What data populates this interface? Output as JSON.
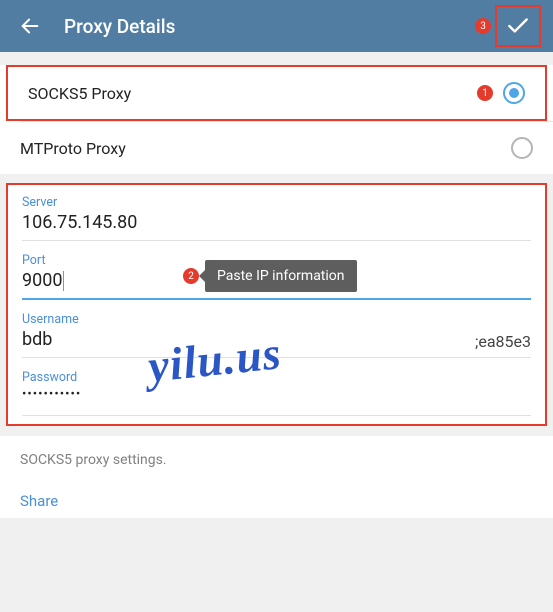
{
  "header": {
    "title": "Proxy Details"
  },
  "annotations": {
    "step1": "1",
    "step2": "2",
    "step3": "3",
    "tooltip": "Paste IP information"
  },
  "proxyTypes": {
    "socks5": "SOCKS5 Proxy",
    "mtproto": "MTProto Proxy"
  },
  "form": {
    "server": {
      "label": "Server",
      "value": "106.75.145.80"
    },
    "port": {
      "label": "Port",
      "value": "9000"
    },
    "username": {
      "label": "Username",
      "value": "bdb",
      "suffix": ";ea85e3"
    },
    "password": {
      "label": "Password",
      "value": "•••••••••••"
    }
  },
  "footer": {
    "note": "SOCKS5 proxy settings.",
    "share": "Share"
  },
  "watermark": "yilu.us"
}
